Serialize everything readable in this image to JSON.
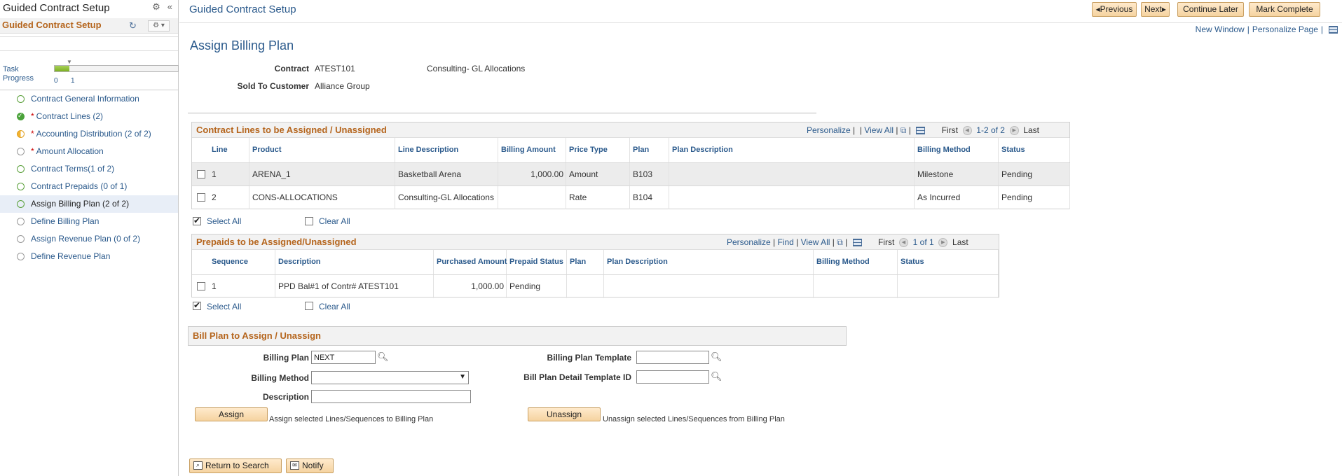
{
  "sidebar": {
    "title": "Guided Contract Setup",
    "band_title": "Guided Contract Setup",
    "task_progress_label": "Task Progress",
    "progress_min": "0",
    "progress_max": "1",
    "progress_fraction": 0.12,
    "steps": [
      {
        "label": "Contract General Information",
        "required": false,
        "status": "open-green"
      },
      {
        "label": "Contract Lines (2)",
        "required": true,
        "status": "done"
      },
      {
        "label": "Accounting Distribution (2 of 2)",
        "required": true,
        "status": "half"
      },
      {
        "label": "Amount Allocation",
        "required": true,
        "status": "grey"
      },
      {
        "label": "Contract Terms(1 of 2)",
        "required": false,
        "status": "open-green"
      },
      {
        "label": "Contract Prepaids (0 of 1)",
        "required": false,
        "status": "open-green"
      },
      {
        "label": "Assign Billing Plan (2 of 2)",
        "required": false,
        "status": "open-green"
      },
      {
        "label": "Define Billing Plan",
        "required": false,
        "status": "grey"
      },
      {
        "label": "Assign Revenue Plan (0 of 2)",
        "required": false,
        "status": "grey"
      },
      {
        "label": "Define Revenue Plan",
        "required": false,
        "status": "grey"
      }
    ]
  },
  "header": {
    "title": "Guided Contract Setup",
    "prev": "Previous",
    "next": "Next",
    "continue_later": "Continue Later",
    "mark_complete": "Mark Complete",
    "new_window": "New Window",
    "personalize_page": "Personalize Page"
  },
  "page": {
    "heading": "Assign Billing Plan",
    "contract_label": "Contract",
    "contract_value": "ATEST101",
    "contract_desc": "Consulting- GL Allocations",
    "sold_to_label": "Sold To Customer",
    "sold_to_value": "Alliance Group"
  },
  "lines_grid": {
    "title": "Contract Lines to be Assigned / Unassigned",
    "personalize": "Personalize",
    "view_all": "View All",
    "first": "First",
    "range": "1-2 of 2",
    "last": "Last",
    "columns": [
      "Line",
      "Product",
      "Line Description",
      "Billing Amount",
      "Price Type",
      "Plan",
      "Plan Description",
      "Billing Method",
      "Status"
    ],
    "rows": [
      {
        "line": "1",
        "product": "ARENA_1",
        "desc": "Basketball Arena",
        "amount": "1,000.00",
        "price_type": "Amount",
        "plan": "B103",
        "plan_desc": "",
        "method": "Milestone",
        "status": "Pending"
      },
      {
        "line": "2",
        "product": "CONS-ALLOCATIONS",
        "desc": "Consulting-GL Allocations",
        "amount": "",
        "price_type": "Rate",
        "plan": "B104",
        "plan_desc": "",
        "method": "As Incurred",
        "status": "Pending"
      }
    ],
    "select_all": "Select All",
    "clear_all": "Clear All"
  },
  "prepaids_grid": {
    "title": "Prepaids to be Assigned/Unassigned",
    "personalize": "Personalize",
    "find": "Find",
    "view_all": "View All",
    "first": "First",
    "range": "1 of 1",
    "last": "Last",
    "columns": [
      "Sequence",
      "Description",
      "Purchased Amount",
      "Prepaid Status",
      "Plan",
      "Plan Description",
      "Billing Method",
      "Status"
    ],
    "rows": [
      {
        "seq": "1",
        "desc": "PPD Bal#1 of Contr# ATEST101",
        "amount": "1,000.00",
        "prepaid_status": "Pending",
        "plan": "",
        "plan_desc": "",
        "method": "",
        "status": ""
      }
    ],
    "select_all": "Select All",
    "clear_all": "Clear All"
  },
  "bill_plan": {
    "title": "Bill Plan to Assign / Unassign",
    "billing_plan_label": "Billing Plan",
    "billing_plan_value": "NEXT",
    "billing_method_label": "Billing Method",
    "billing_method_value": "",
    "description_label": "Description",
    "description_value": "",
    "template_label": "Billing Plan Template",
    "template_value": "",
    "detail_template_label": "Bill Plan Detail Template ID",
    "detail_template_value": "",
    "assign": "Assign",
    "assign_hint": "Assign selected Lines/Sequences to Billing Plan",
    "unassign": "Unassign",
    "unassign_hint": "Unassign selected Lines/Sequences from Billing Plan"
  },
  "footer": {
    "return_to_search": "Return to Search",
    "notify": "Notify"
  }
}
